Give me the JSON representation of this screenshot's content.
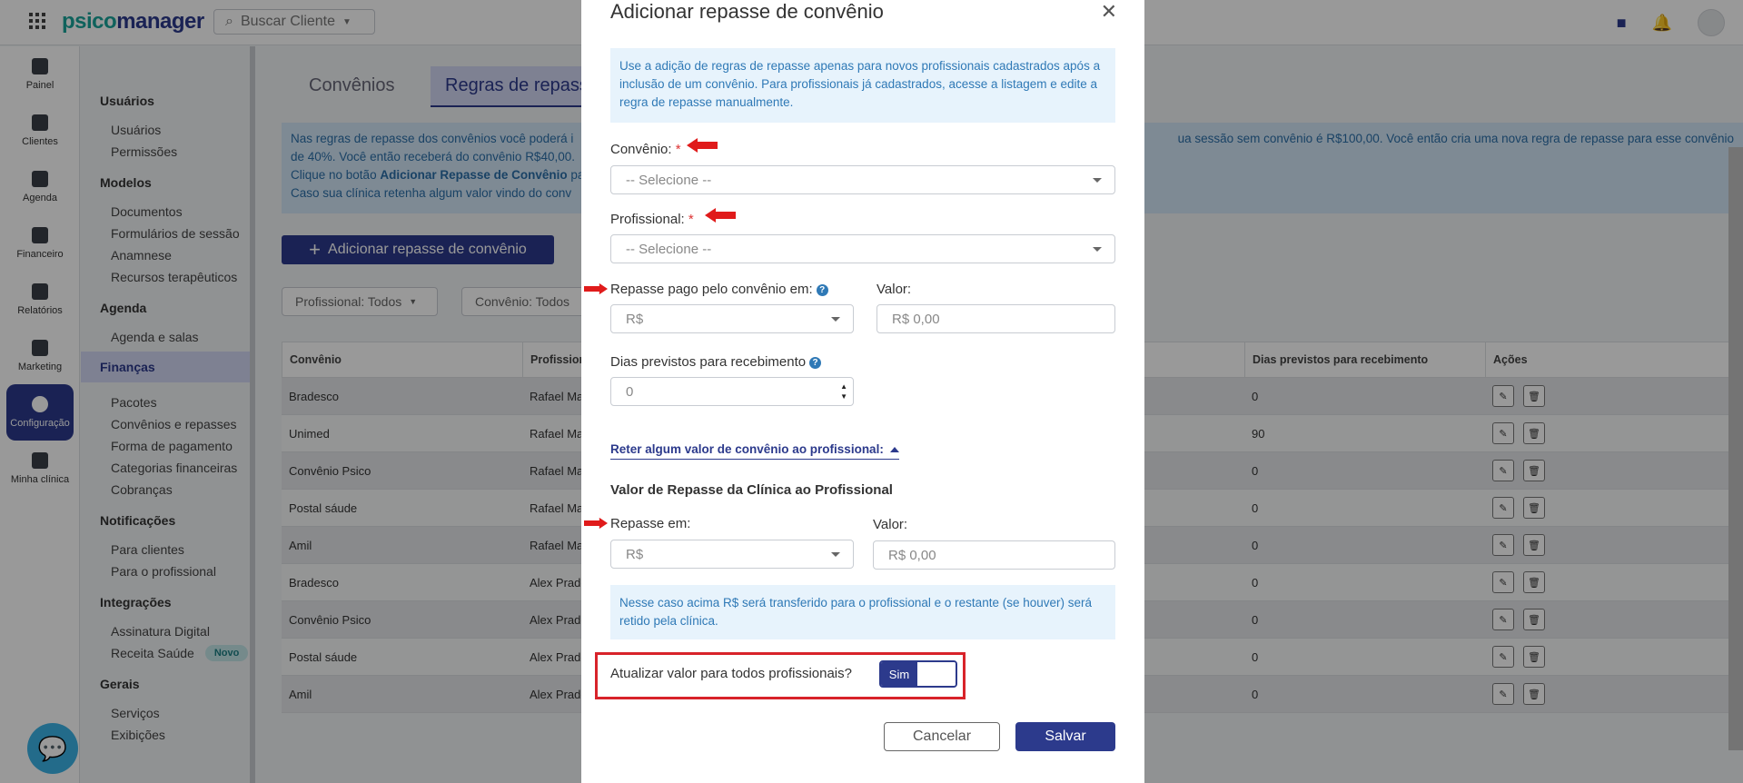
{
  "topbar": {
    "logo_part1": "psico",
    "logo_part2": "manager",
    "search_label": "Buscar Cliente"
  },
  "rail": [
    {
      "label": "Painel",
      "icon": "dashboard-icon"
    },
    {
      "label": "Clientes",
      "icon": "users-icon"
    },
    {
      "label": "Agenda",
      "icon": "calendar-icon"
    },
    {
      "label": "Financeiro",
      "icon": "money-icon"
    },
    {
      "label": "Relatórios",
      "icon": "report-icon"
    },
    {
      "label": "Marketing",
      "icon": "megaphone-icon"
    },
    {
      "label": "Configuração",
      "icon": "gear-icon"
    },
    {
      "label": "Minha clínica",
      "icon": "building-icon"
    }
  ],
  "settings_nav": {
    "g1": "Usuários",
    "g1_items": [
      "Usuários",
      "Permissões"
    ],
    "g2": "Modelos",
    "g2_items": [
      "Documentos",
      "Formulários de sessão",
      "Anamnese",
      "Recursos terapêuticos"
    ],
    "g3": "Agenda",
    "g3_items": [
      "Agenda e salas"
    ],
    "g4": "Finanças",
    "g4_items": [
      "Pacotes",
      "Convênios e repasses",
      "Forma de pagamento",
      "Categorias financeiras",
      "Cobranças"
    ],
    "g5": "Notificações",
    "g5_items": [
      "Para clientes",
      "Para o profissional"
    ],
    "g6": "Integrações",
    "g6_items": [
      "Assinatura Digital",
      "Receita Saúde"
    ],
    "badge_new": "Novo",
    "g7": "Gerais",
    "g7_items": [
      "Serviços",
      "Exibições"
    ]
  },
  "main": {
    "tab1": "Convênios",
    "tab2": "Regras de repass",
    "info_line1": "Nas regras de repasse dos convênios você poderá i",
    "info_line1_right": "ua sessão sem convênio é R$100,00. Você então cria uma nova regra de repasse para esse convênio",
    "info_line2": "de 40%. Você então receberá do convênio R$40,00.",
    "info_line3_a": "Clique no botão ",
    "info_line3_b": "Adicionar Repasse de Convênio",
    "info_line3_c": " pa",
    "info_line4": "Caso sua clínica retenha algum valor vindo do conv",
    "add_button": "Adicionar repasse de convênio",
    "filter_prof": "Profissional: Todos",
    "filter_conv": "Convênio: Todos",
    "columns": [
      "Convênio",
      "Profission",
      "Dias previstos para recebimento",
      "Ações"
    ],
    "rows": [
      {
        "conv": "Bradesco",
        "prof": "Rafael Ma",
        "dias": "0"
      },
      {
        "conv": "Unimed",
        "prof": "Rafael Ma",
        "dias": "90"
      },
      {
        "conv": "Convênio Psico",
        "prof": "Rafael Ma",
        "dias": "0"
      },
      {
        "conv": "Postal sáude",
        "prof": "Rafael Ma",
        "dias": "0"
      },
      {
        "conv": "Amil",
        "prof": "Rafael Ma",
        "dias": "0"
      },
      {
        "conv": "Bradesco",
        "prof": "Alex Prade",
        "dias": "0"
      },
      {
        "conv": "Convênio Psico",
        "prof": "Alex Prade",
        "dias": "0"
      },
      {
        "conv": "Postal sáude",
        "prof": "Alex Prade",
        "dias": "0"
      },
      {
        "conv": "Amil",
        "prof": "Alex Prade",
        "dias": "0"
      }
    ]
  },
  "modal": {
    "title": "Adicionar repasse de convênio",
    "info": "Use a adição de regras de repasse apenas para novos profissionais cadastrados após a inclusão de um convênio. Para profissionais já cadastrados, acesse a listagem e edite a regra de repasse manualmente.",
    "convenio_label": "Convênio:",
    "convenio_placeholder": "-- Selecione --",
    "profissional_label": "Profissional:",
    "profissional_placeholder": "-- Selecione --",
    "repasse_pago_label": "Repasse pago pelo convênio em:",
    "repasse_pago_value": "R$",
    "valor_label": "Valor:",
    "valor_placeholder": "R$ 0,00",
    "dias_label": "Dias previstos para recebimento",
    "dias_value": "0",
    "reter_link": "Reter algum valor de convênio ao profissional:",
    "section_heading": "Valor de Repasse da Clínica ao Profissional",
    "repasse_em_label": "Repasse em:",
    "repasse_em_value": "R$",
    "valor2_label": "Valor:",
    "valor2_placeholder": "R$ 0,00",
    "note": "Nesse caso acima R$ será transferido para o profissional e o restante (se houver) será retido pela clínica.",
    "atualizar_label": "Atualizar valor para todos profissionais?",
    "toggle_label": "Sim",
    "cancel": "Cancelar",
    "save": "Salvar"
  }
}
